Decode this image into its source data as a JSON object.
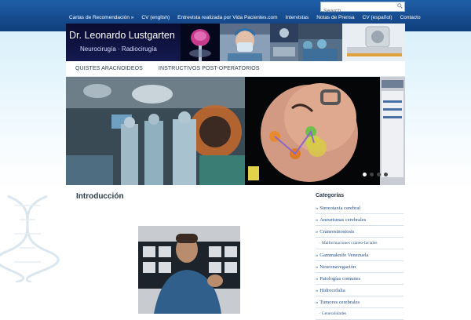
{
  "search": {
    "placeholder": "Search"
  },
  "nav": {
    "items": [
      "Cartas de Recomendación »",
      "CV (english)",
      "Entrevista realizada por Vida Pacientes.com",
      "Intervistas",
      "Notas de Prensa",
      "CV (español)",
      "Contacto"
    ]
  },
  "header": {
    "name": "Dr. Leonardo Lustgarten",
    "subtitle": "Neurocirugía · Radiocirugía"
  },
  "submenu": {
    "items": [
      "QUISTES ARACNOIDEOS",
      "INSTRUCTIVOS POST-OPERATORIOS"
    ]
  },
  "slider": {
    "slide_count": 4,
    "active_index": 0
  },
  "main": {
    "title": "Introducción"
  },
  "sidebar": {
    "title": "Categorías",
    "categories": [
      {
        "label": "Stereotaxia cerebral",
        "sub": false
      },
      {
        "label": "Aneurismas cerebrales",
        "sub": false
      },
      {
        "label": "Craneosinostosis",
        "sub": false
      },
      {
        "label": "Malformaciones cráneo-faciales",
        "sub": true
      },
      {
        "label": "Gammaknife Venezuela",
        "sub": false
      },
      {
        "label": "Neuronavegación",
        "sub": false
      },
      {
        "label": "Patologías comunes",
        "sub": false
      },
      {
        "label": "Hidrocefalia",
        "sub": false
      },
      {
        "label": "Tumores cerebrales",
        "sub": false
      },
      {
        "label": "Generalidades",
        "sub": true
      }
    ]
  },
  "colors": {
    "topbar": "#1f5fa8",
    "link": "#24508b",
    "band": "#d9f0fa"
  }
}
